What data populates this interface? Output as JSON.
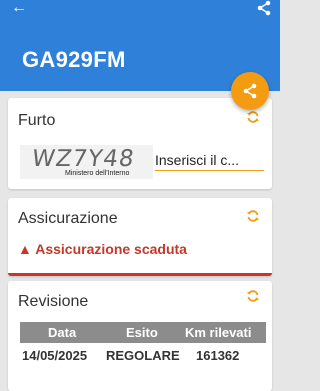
{
  "header": {
    "plate": "GA929FM",
    "back_icon": "arrow-left-icon",
    "share_icon": "share-icon"
  },
  "fab": {
    "icon": "share-icon",
    "color": "#f39c12"
  },
  "furto": {
    "title": "Furto",
    "captcha_text": "WZ7Y48",
    "captcha_caption": "Ministero dell'Interno",
    "input_placeholder": "Inserisci il c..."
  },
  "assicurazione": {
    "title": "Assicurazione",
    "warning_text": "▲ Assicurazione scaduta",
    "warning_color": "#c0392b"
  },
  "revisione": {
    "title": "Revisione",
    "columns": [
      "Data",
      "Esito",
      "Km rilevati"
    ],
    "rows": [
      [
        "14/05/2025",
        "REGOLARE",
        "161362"
      ]
    ]
  },
  "colors": {
    "appbar": "#2f80d8",
    "accent": "#f39c12"
  }
}
